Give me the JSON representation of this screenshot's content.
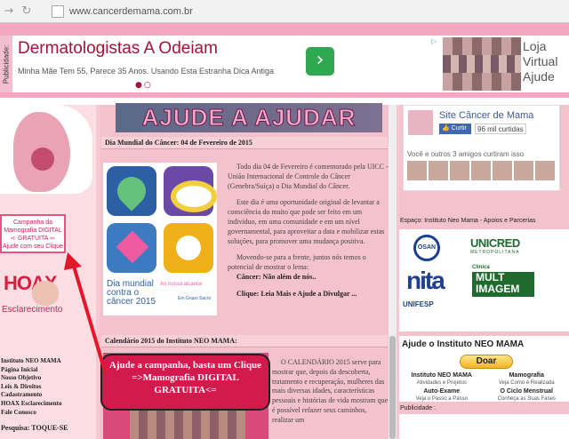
{
  "browser": {
    "url": "www.cancerdemama.com.br"
  },
  "ad": {
    "pub_label": "Publicidade:",
    "headline": "Dermatologistas A Odeiam",
    "sub": "Minha Mãe Tem 55, Parece 35 Anos. Usando Esta Estranha Dica Antiga",
    "go_symbol": "›",
    "dots": "●○",
    "side_text": "Loja Virtual Ajude"
  },
  "left": {
    "campaign": {
      "line1": "Campanha da",
      "line2": "Mamografia DIGITAL",
      "line3": "GRATUITA",
      "line4": "Ajude com seu Clique"
    },
    "hoax": "HOAX",
    "esclarecimento": "Esclarecimento",
    "menu": [
      "Instituto NEO MAMA",
      "Página Inicial",
      "Nosso Objetivo",
      "Leis & Direitos",
      "Cadastramento",
      "HOAX Esclarecimento",
      "Fale Conosco"
    ],
    "pesquisa": "Pesquisa: TOQUE-SE"
  },
  "main": {
    "banner": "AJUDE A AJUDAR",
    "post1_title": "Dia Mundial do Câncer: 04 de Fevereiro de 2015",
    "art_caption1": "Dia mundial contra o câncer 2015",
    "art_caption2": "Ao nosso alcance",
    "art_caption3": "Em Grupo Sacro",
    "p1": "Todo dia 04 de Fevereiro é comemorado pela UICC - União Internacional de Controle do Câncer (Genebra/Suíça) o Dia Mundial do Câncer.",
    "p2": "Este dia é uma oportunidade original de levantar a consciência do muito que pode ser feito em um indivíduo, em uma comunidade e em um nível governamental, para aproveitar a data e mobilizar estas soluções, para promover uma mudança positiva.",
    "p3": "Movendo-se para a frente, juntos nós temos o potencial de mostrar o lema:",
    "p3b": "Câncer: Não além de nós..",
    "p4": "Clique: Leia Mais e Ajude a Divulgar ...",
    "post2_title": "Calendário 2015 do Instituto NEO MAMA:",
    "p5": "O CALENDÁRIO 2015 serve para mostrar que, depois da descoberta, tratamento e recuperação, mulheres das mais diversas idades, características pessoais e histórias de vida mostram que é possível refazer seus caminhos, realizar um",
    "callout": "Ajude a campanha, basta um Clique =>Mamografia DIGITAL GRATUITA<="
  },
  "right": {
    "fb_title": "Site Câncer de Mama",
    "fb_curtir": "Curtir",
    "fb_count": "96 mil curtidas",
    "fb_friends": "Você e outros 3 amigos curtiram isso",
    "neo_title": "Espaço: Instituto Neo Mama - Apoios e Parcerias",
    "logo_osan": "OSAN",
    "logo_unicred": "UNICRED",
    "logo_unicred_sub": "METROPOLITANA",
    "logo_nita": "nita",
    "logo_clinica": "Clínica",
    "logo_multimagem": "MULT IMAGEM",
    "logo_unifesp": "UNIFESP",
    "ajude_title": "Ajude o Instituto NEO MAMA",
    "doar": "Doar",
    "grid": [
      {
        "t": "Instituto NEO MAMA",
        "s": "Atividades e Projetos"
      },
      {
        "t": "Mamografia",
        "s": "Veja Como é Realizada"
      },
      {
        "t": "Auto-Exame",
        "s": "Veja o Passo a Passo"
      },
      {
        "t": "O Ciclo Menstrual",
        "s": "Conheça as Suas Fases"
      }
    ],
    "publicidade": "Publicidade :"
  },
  "colors": {
    "pink_bg": "#f6c9d3",
    "accent": "#d21a4d",
    "ad_headline": "#a3123a"
  }
}
